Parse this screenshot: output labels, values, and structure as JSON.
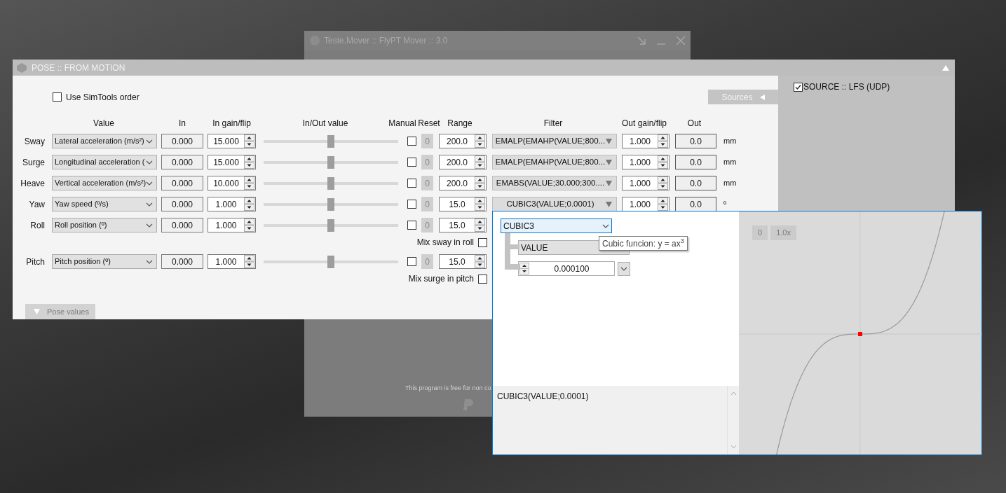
{
  "background_window": {
    "title": "Teste.Mover :: FlyPT Mover :: 3.0",
    "footer_text": "This program is free for non co"
  },
  "main_window": {
    "title": "POSE :: FROM MOTION",
    "use_simtools_order": {
      "label": "Use SimTools order",
      "checked": false
    },
    "sources_tab": {
      "label": "Sources"
    },
    "columns": [
      "Value",
      "In",
      "In gain/flip",
      "In/Out value",
      "Manual",
      "Reset",
      "Range",
      "Filter",
      "Out gain/flip",
      "Out"
    ],
    "rows": [
      {
        "axis": "Sway",
        "value": "Lateral acceleration (m/s²)",
        "in": "0.000",
        "in_gain": "15.000",
        "level": 0.5,
        "manual": false,
        "reset": "0",
        "range": "200.0",
        "filter": "EMALP(EMAHP(VALUE;800...",
        "out_gain": "1.000",
        "out": "0.0",
        "unit": "mm"
      },
      {
        "axis": "Surge",
        "value": "Longitudinal acceleration (",
        "in": "0.000",
        "in_gain": "15.000",
        "level": 0.5,
        "manual": false,
        "reset": "0",
        "range": "200.0",
        "filter": "EMALP(EMAHP(VALUE;800...",
        "out_gain": "1.000",
        "out": "0.0",
        "unit": "mm"
      },
      {
        "axis": "Heave",
        "value": "Vertical acceleration (m/s²)",
        "in": "0.000",
        "in_gain": "10.000",
        "level": 0.5,
        "manual": false,
        "reset": "0",
        "range": "200.0",
        "filter": "EMABS(VALUE;30.000;300....",
        "out_gain": "1.000",
        "out": "0.0",
        "unit": "mm"
      },
      {
        "axis": "Yaw",
        "value": "Yaw speed (º/s)",
        "in": "0.000",
        "in_gain": "1.000",
        "level": 0.5,
        "manual": false,
        "reset": "0",
        "range": "15.0",
        "filter": "CUBIC3(VALUE;0.0001)",
        "out_gain": "1.000",
        "out": "0.0",
        "unit": "º"
      },
      {
        "axis": "Roll",
        "value": "Roll position (º)",
        "in": "0.000",
        "in_gain": "1.000",
        "level": 0.5,
        "manual": false,
        "reset": "0",
        "range": "15.0",
        "mix": {
          "label": "Mix sway in roll",
          "checked": false
        }
      },
      {
        "axis": "Pitch",
        "value": "Pitch position (º)",
        "in": "0.000",
        "in_gain": "1.000",
        "level": 0.5,
        "manual": false,
        "reset": "0",
        "range": "15.0",
        "mix": {
          "label": "Mix surge in pitch",
          "checked": false
        }
      }
    ],
    "pose_values_tab": {
      "label": "Pose values"
    }
  },
  "sources_panel": {
    "items": [
      {
        "label": "SOURCE :: LFS (UDP)",
        "checked": true
      }
    ]
  },
  "filter_editor": {
    "tree": {
      "label": "CUBIC3",
      "children": [
        {
          "kind": "variable",
          "label": "VALUE"
        },
        {
          "kind": "number",
          "value": "0.000100"
        }
      ]
    },
    "tooltip": "Cubic funcion: y = ax$^{3}$",
    "expression": "CUBIC3(VALUE;0.0001)",
    "graph_buttons": [
      "0",
      "1.0x"
    ]
  }
}
